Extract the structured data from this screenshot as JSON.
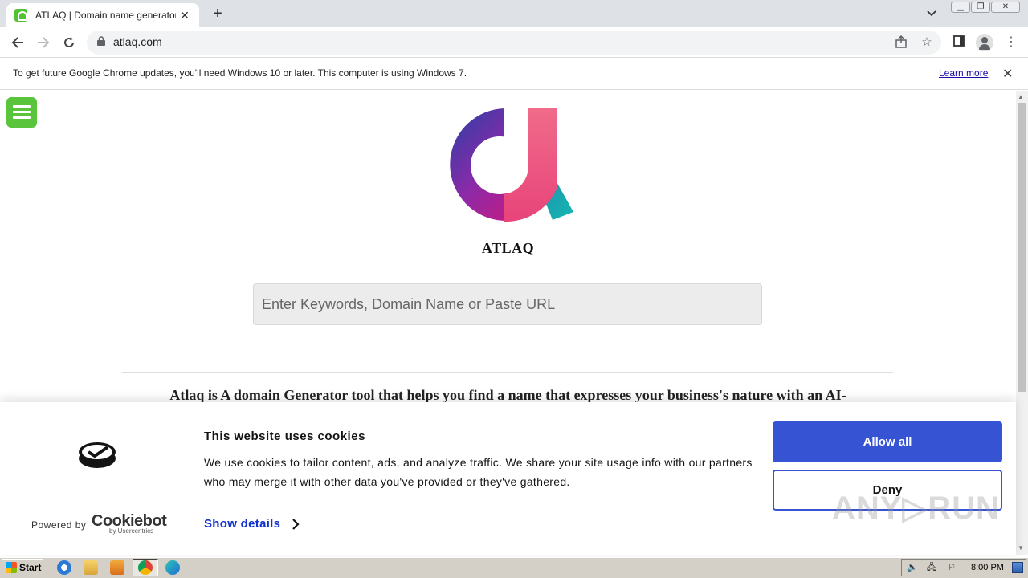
{
  "browser": {
    "tab_title": "ATLAQ | Domain name generator - F",
    "tab_close": "✕",
    "new_tab": "+",
    "url": "atlaq.com",
    "infobar_text": "To get future Google Chrome updates, you'll need Windows 10 or later. This computer is using Windows 7.",
    "infobar_link": "Learn more",
    "infobar_close": "✕"
  },
  "page": {
    "site_name": "ATLAQ",
    "search_placeholder": "Enter Keywords, Domain Name or Paste URL",
    "tagline": "Atlaq is A domain Generator tool that helps you find a name that expresses your business's nature with an AI-"
  },
  "cookie_banner": {
    "title": "This website uses cookies",
    "description": "We use cookies to tailor content, ads, and analyze traffic. We share your site usage info with our partners who may merge it with other data you've provided or they've gathered.",
    "show_details": "Show details",
    "allow_all": "Allow all",
    "deny": "Deny",
    "powered_by": "Powered by",
    "brand": "Cookiebot",
    "brand_sub": "by Usercentrics"
  },
  "watermark": "ANY▷RUN",
  "taskbar": {
    "start_label": "Start",
    "clock": "8:00 PM"
  },
  "colors": {
    "accent_blue": "#3653d4",
    "link_blue": "#1032cf",
    "widget_green": "#5bc43d"
  }
}
